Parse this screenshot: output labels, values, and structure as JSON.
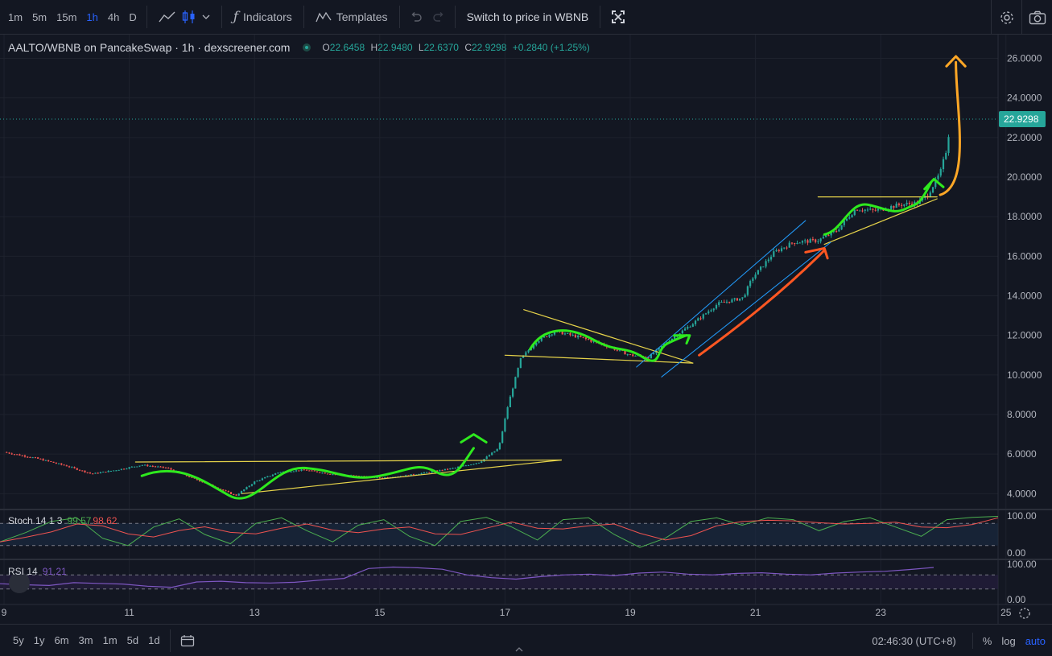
{
  "toolbar": {
    "timeframes": [
      "1m",
      "5m",
      "15m",
      "1h",
      "4h",
      "D"
    ],
    "active_timeframe": "1h",
    "indicators_label": "Indicators",
    "templates_label": "Templates",
    "switch_label": "Switch to price in WBNB"
  },
  "legend": {
    "symbol": "AALTO/WBNB on PancakeSwap · 1h · dexscreener.com",
    "o_label": "O",
    "o": "22.6458",
    "h_label": "H",
    "h": "22.9480",
    "l_label": "L",
    "l": "22.6370",
    "c_label": "C",
    "c": "22.9298",
    "change": "+0.2840 (+1.25%)"
  },
  "stoch": {
    "label": "Stoch 14 1 3",
    "k": "99.57",
    "d": "98.62",
    "axis": [
      "100.00",
      "0.00"
    ]
  },
  "rsi": {
    "label": "RSI 14",
    "value": "91.21",
    "axis": [
      "100.00",
      "0.00"
    ]
  },
  "bottombar": {
    "ranges": [
      "5y",
      "1y",
      "6m",
      "3m",
      "1m",
      "5d",
      "1d"
    ],
    "clock": "02:46:30 (UTC+8)",
    "percent": "%",
    "log": "log",
    "auto": "auto"
  },
  "colors": {
    "up": "#26a69a",
    "down": "#ef5350",
    "background": "#131722",
    "accent": "#2962ff"
  },
  "chart_data": {
    "type": "candlestick",
    "y_ticks": [
      "4.0000",
      "6.0000",
      "8.0000",
      "10.0000",
      "12.0000",
      "14.0000",
      "16.0000",
      "18.0000",
      "20.0000",
      "22.0000",
      "24.0000",
      "26.0000"
    ],
    "ylim": [
      3.2,
      27.2
    ],
    "x_ticks": [
      "9",
      "11",
      "13",
      "15",
      "17",
      "19",
      "21",
      "23",
      "25"
    ],
    "current_price": "22.9298",
    "close_path": [
      [
        9.0,
        6.1
      ],
      [
        9.5,
        5.8
      ],
      [
        10.0,
        5.4
      ],
      [
        10.4,
        5.0
      ],
      [
        10.8,
        5.2
      ],
      [
        11.2,
        5.45
      ],
      [
        11.6,
        5.3
      ],
      [
        12.0,
        4.8
      ],
      [
        12.4,
        4.3
      ],
      [
        12.7,
        3.9
      ],
      [
        13.0,
        4.6
      ],
      [
        13.4,
        5.1
      ],
      [
        13.8,
        5.2
      ],
      [
        14.2,
        5.0
      ],
      [
        14.6,
        4.9
      ],
      [
        15.0,
        4.8
      ],
      [
        15.4,
        4.9
      ],
      [
        15.8,
        5.1
      ],
      [
        16.2,
        5.3
      ],
      [
        16.6,
        5.6
      ],
      [
        16.9,
        6.3
      ],
      [
        17.05,
        8.5
      ],
      [
        17.25,
        10.8
      ],
      [
        17.5,
        11.7
      ],
      [
        17.8,
        12.2
      ],
      [
        18.2,
        11.9
      ],
      [
        18.6,
        11.5
      ],
      [
        19.0,
        11.0
      ],
      [
        19.3,
        10.9
      ],
      [
        19.6,
        11.7
      ],
      [
        20.0,
        12.6
      ],
      [
        20.4,
        13.6
      ],
      [
        20.8,
        13.9
      ],
      [
        20.95,
        14.9
      ],
      [
        21.3,
        16.2
      ],
      [
        21.6,
        16.7
      ],
      [
        22.0,
        16.8
      ],
      [
        22.3,
        17.3
      ],
      [
        22.6,
        18.4
      ],
      [
        22.9,
        18.3
      ],
      [
        23.3,
        18.6
      ],
      [
        23.6,
        18.7
      ],
      [
        23.75,
        19.1
      ],
      [
        23.95,
        20.2
      ],
      [
        24.05,
        21.4
      ],
      [
        24.12,
        22.93
      ]
    ],
    "stoch_k": [
      30,
      55,
      85,
      95,
      40,
      20,
      70,
      92,
      50,
      25,
      80,
      95,
      60,
      30,
      75,
      90,
      45,
      20,
      85,
      96,
      70,
      35,
      90,
      95,
      50,
      15,
      40,
      85,
      95,
      75,
      95,
      90,
      60,
      85,
      95,
      70,
      45,
      90,
      96,
      99
    ],
    "rsi": [
      45,
      42,
      40,
      48,
      46,
      44,
      38,
      35,
      50,
      52,
      48,
      47,
      49,
      55,
      60,
      88,
      92,
      90,
      86,
      70,
      62,
      58,
      65,
      70,
      72,
      68,
      75,
      78,
      72,
      70,
      74,
      76,
      72,
      70,
      75,
      78,
      80,
      85,
      91
    ]
  }
}
